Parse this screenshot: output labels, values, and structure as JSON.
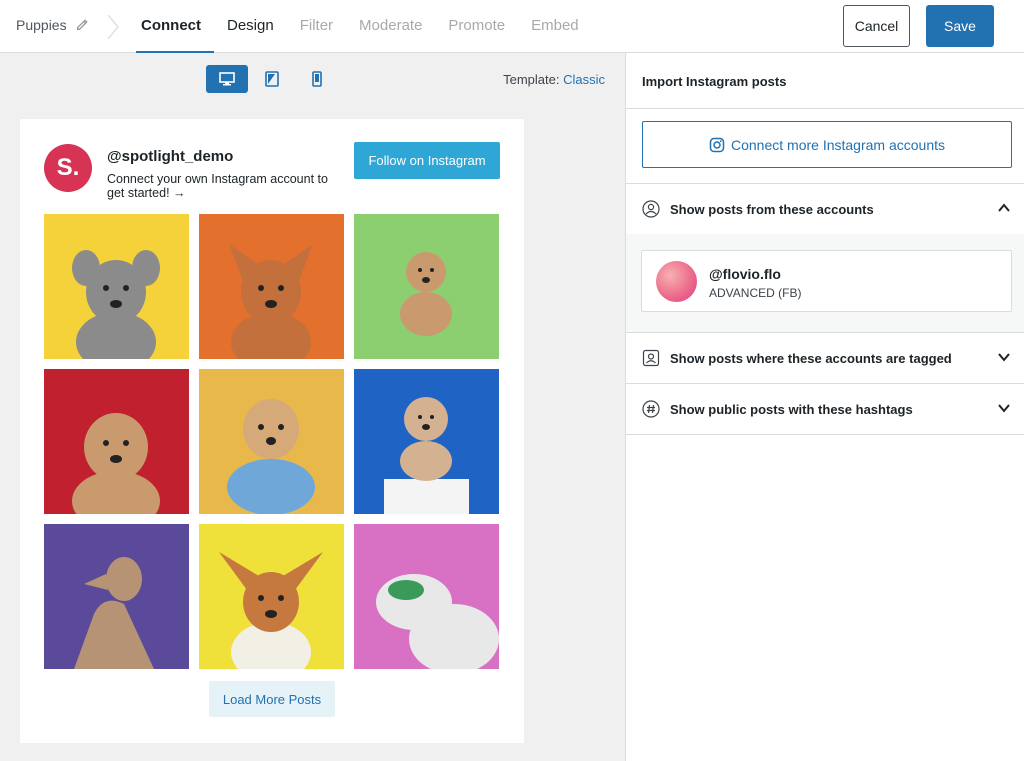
{
  "header": {
    "feed_name": "Puppies",
    "tabs": [
      {
        "label": "Connect",
        "state": "active"
      },
      {
        "label": "Design",
        "state": "enabled"
      },
      {
        "label": "Filter",
        "state": "disabled"
      },
      {
        "label": "Moderate",
        "state": "disabled"
      },
      {
        "label": "Promote",
        "state": "disabled"
      },
      {
        "label": "Embed",
        "state": "disabled"
      }
    ],
    "cancel_label": "Cancel",
    "save_label": "Save"
  },
  "preview": {
    "devices": [
      "desktop-icon",
      "tablet-icon",
      "phone-icon"
    ],
    "active_device": "desktop-icon",
    "template_label": "Template:",
    "template_value": "Classic",
    "feed": {
      "logo_letter": "S.",
      "username": "@spotlight_demo",
      "bio": "Connect your own Instagram account to get started! →",
      "follow_label": "Follow on Instagram",
      "load_more_label": "Load More Posts",
      "posts": [
        {
          "bg": "#f5d23a",
          "dog": "#8b8b8b"
        },
        {
          "bg": "#e4702e",
          "dog": "#c4703d"
        },
        {
          "bg": "#8ccf71",
          "dog": "#c89a6e"
        },
        {
          "bg": "#c1212f",
          "dog": "#c89a6e"
        },
        {
          "bg": "#e8b94a",
          "dog": "#d6a979"
        },
        {
          "bg": "#1f63c4",
          "dog": "#d4b190"
        },
        {
          "bg": "#5a4a99",
          "dog": "#b79375"
        },
        {
          "bg": "#f0e03a",
          "dog": "#c5793f"
        },
        {
          "bg": "#d870c4",
          "dog": "#e8e8e8"
        }
      ]
    }
  },
  "sidebar": {
    "title": "Import Instagram posts",
    "connect_label": "Connect more Instagram accounts",
    "sections": {
      "accounts": {
        "label": "Show posts from these accounts",
        "icon": "user-icon",
        "expanded": true
      },
      "tagged": {
        "label": "Show posts where these accounts are tagged",
        "icon": "tagged-user-icon",
        "expanded": false
      },
      "hashtags": {
        "label": "Show public posts with these hashtags",
        "icon": "hashtag-icon",
        "expanded": false
      }
    },
    "account": {
      "name": "@flovio.flo",
      "type": "ADVANCED (FB)"
    }
  },
  "colors": {
    "accent": "#2271b1",
    "follow_button": "#2ea7d6",
    "logo": "#d63355"
  }
}
